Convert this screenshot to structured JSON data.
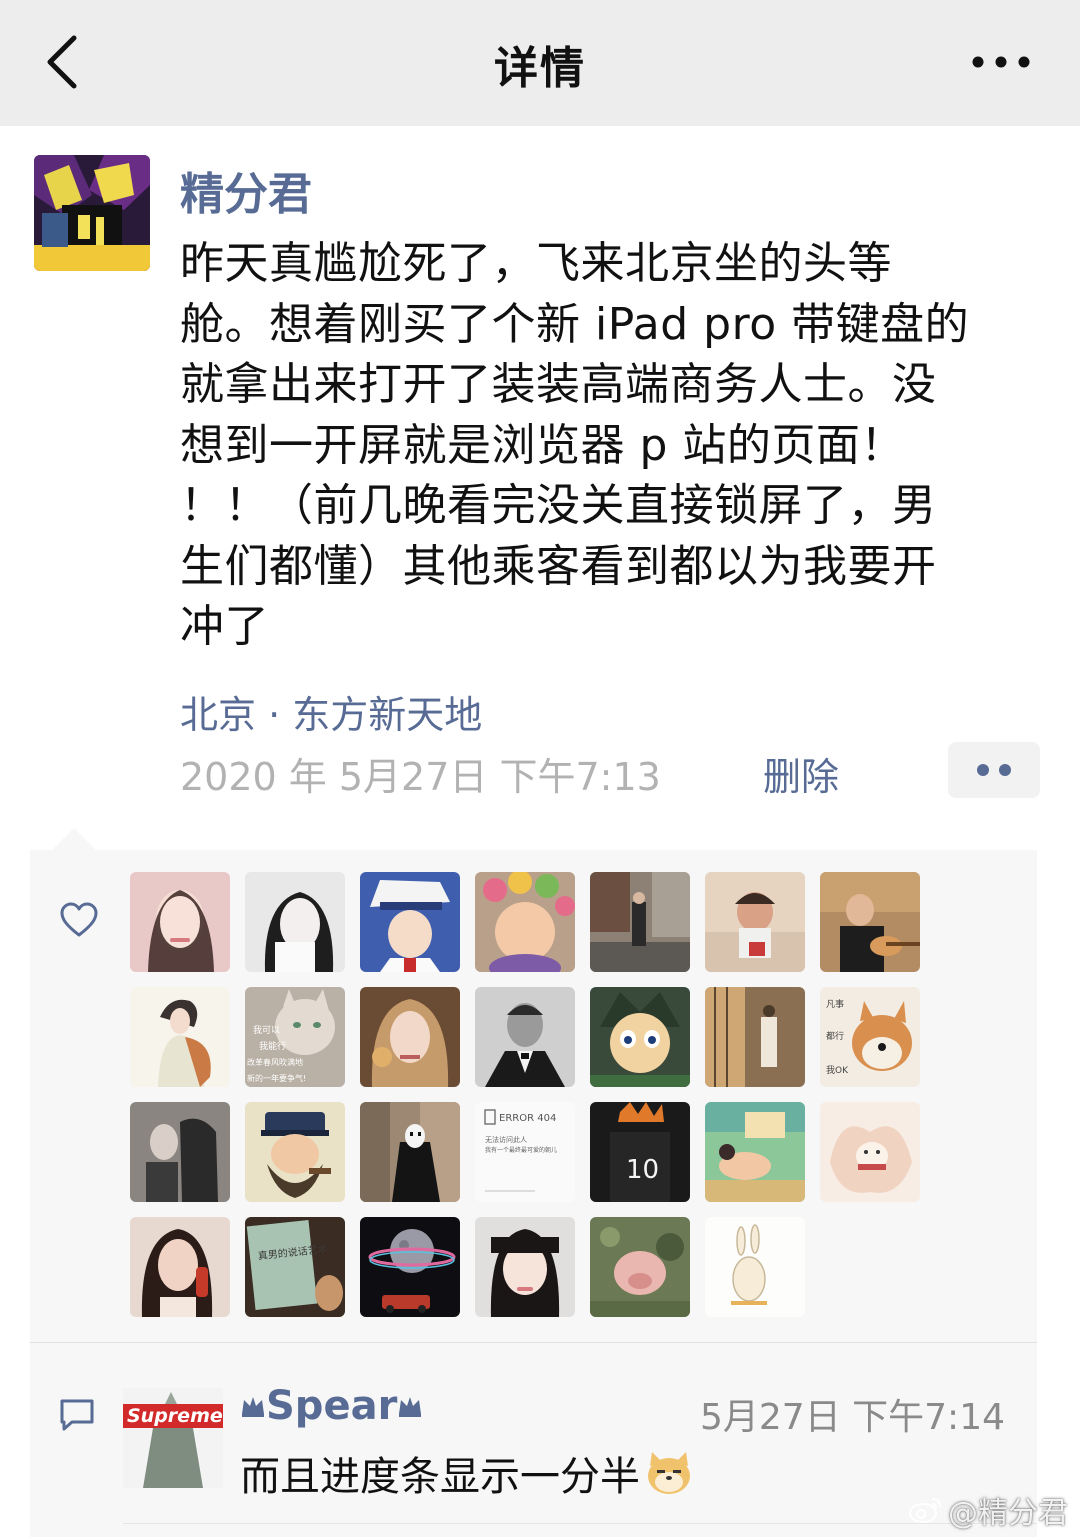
{
  "nav": {
    "title": "详情",
    "back_icon": "chevron-left-icon",
    "more_icon": "more-horizontal-icon"
  },
  "post": {
    "author": "精分君",
    "text": "昨天真尴尬死了，飞来北京坐的头等舱。想着刚买了个新iPad pro带键盘的就拿出来打开了装装高端商务人士。没想到一开屏就是浏览器p站的页面！！！（前几晚看完没关直接锁屏了，男生们都懂）其他乘客看到都以为我要开冲了",
    "lines": [
      "昨天真尴尬死了，飞来北京坐的头等",
      "舱。想着刚买了个新 iPad pro 带键盘的",
      "就拿出来打开了装装高端商务人士。没",
      "想到一开屏就是浏览器 p 站的页面！",
      "！！（前几晚看完没关直接锁屏了，男",
      "生们都懂）其他乘客看到都以为我要开",
      "冲了"
    ],
    "location": "北京 · 东方新天地",
    "timestamp": "2020 年 5月27日  下午7:13",
    "delete_label": "删除"
  },
  "likes": {
    "icon": "heart-icon",
    "avatars": [
      "liker-girl-pink",
      "liker-girl-bw",
      "liker-kid-detective",
      "liker-baby-rollers",
      "liker-street-man",
      "liker-toddler",
      "liker-man-ukulele",
      "liker-illustrated-girl",
      "liker-cat-meme",
      "liker-girl-ornament",
      "liker-man-suit",
      "liker-anime-boy",
      "liker-sunlit-room",
      "liker-shiba-dog",
      "liker-couple-bw",
      "liker-captain-cartoon",
      "liker-no-face",
      "liker-error-404",
      "liker-jersey-10",
      "liker-green-illustration",
      "liker-fox-spirit",
      "liker-woman-phone",
      "liker-book-cover",
      "liker-planet-night",
      "liker-girl-smile",
      "liker-pig-flowers",
      "liker-rabbit-sketch"
    ],
    "meme_text": [
      "我可以",
      "我能行",
      "改革春风吹满地",
      "新的一年要争气!"
    ],
    "shiba_text": [
      "凡事",
      "都行",
      "我OK"
    ],
    "error_text": [
      "ERROR 404",
      "无法访问此人",
      "我有一个最终最可爱的朝儿"
    ],
    "jersey_number": "10",
    "book_text": "真男的说话艺术"
  },
  "comment": {
    "icon": "comment-icon",
    "avatar_text": "Supreme",
    "username": "Spear",
    "time": "5月27日  下午7:14",
    "text": "而且进度条显示一分半",
    "emoji": "doge-emoji"
  },
  "watermark": "@精分君",
  "colors": {
    "nav_bg": "#ededed",
    "link_blue": "#576b95",
    "time_gray": "#b2b2b2",
    "panel_bg": "#f7f7f7"
  }
}
